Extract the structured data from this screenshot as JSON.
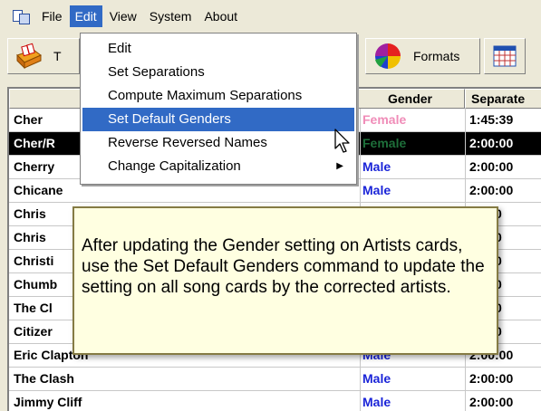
{
  "menubar": {
    "items": [
      {
        "label": "File"
      },
      {
        "label": "Edit"
      },
      {
        "label": "View"
      },
      {
        "label": "System"
      },
      {
        "label": "About"
      }
    ]
  },
  "toolbar": {
    "left_label": "T",
    "formats_label": "Formats"
  },
  "table": {
    "headers": {
      "gender": "Gender",
      "separation": "Separate"
    },
    "rows": [
      {
        "artist": "Cher",
        "gender": "Female",
        "sep": "1:45:39"
      },
      {
        "artist": "Cher/R",
        "gender": "Female",
        "sep": "2:00:00"
      },
      {
        "artist": "Cherry",
        "gender": "Male",
        "sep": "2:00:00"
      },
      {
        "artist": "Chicane",
        "gender": "Male",
        "sep": "2:00:00"
      },
      {
        "artist": "Chris",
        "gender": "",
        "sep": "00:00"
      },
      {
        "artist": "Chris",
        "gender": "",
        "sep": "00:00"
      },
      {
        "artist": "Christi",
        "gender": "",
        "sep": "00:00"
      },
      {
        "artist": "Chumb",
        "gender": "",
        "sep": "00:00"
      },
      {
        "artist": "The Cl",
        "gender": "",
        "sep": "00:00"
      },
      {
        "artist": "Citizer",
        "gender": "",
        "sep": "00:00"
      },
      {
        "artist": "Eric Clapton",
        "gender": "Male",
        "sep": "2:00:00"
      },
      {
        "artist": "The Clash",
        "gender": "Male",
        "sep": "2:00:00"
      },
      {
        "artist": "Jimmy Cliff",
        "gender": "Male",
        "sep": "2:00:00"
      }
    ]
  },
  "dropdown": {
    "items": [
      {
        "label": "Edit"
      },
      {
        "label": "Set Separations"
      },
      {
        "label": "Compute Maximum Separations"
      },
      {
        "label": "Set Default Genders"
      },
      {
        "label": "Reverse Reversed Names"
      },
      {
        "label": "Change Capitalization"
      }
    ]
  },
  "tooltip": {
    "text": "After updating the Gender setting on Artists cards, use the Set Default Genders command to update the setting on all song cards by the corrected artists."
  },
  "colors": {
    "menu_highlight": "#316ac5",
    "male": "#1a24d8",
    "female": "#f08cb8",
    "tooltip_bg": "#ffffe1"
  }
}
